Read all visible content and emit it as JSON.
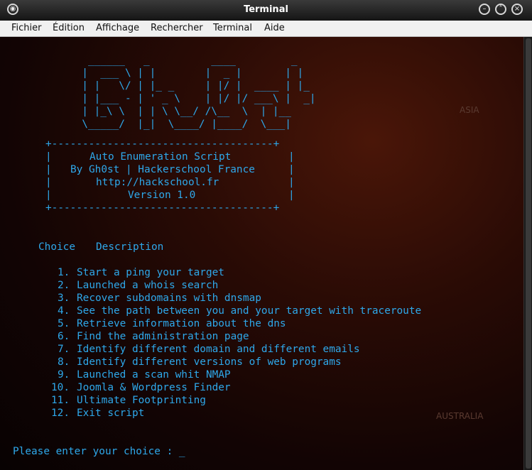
{
  "window": {
    "title": "Terminal"
  },
  "menu": [
    "Fichier",
    "Édition",
    "Affichage",
    "Rechercher",
    "Terminal",
    "Aide"
  ],
  "colors": {
    "terminal_text": "#2ea8ea"
  },
  "banner": {
    "ascii": [
      "         ______   _          ____         _",
      "        |  ___ \\ | |        |  _ |       | |",
      "        | |   \\/ | |_ _     | |/ |  ____ | |_",
      "        | |___ - | ' _ \\    | |/ |/ ___\\ |  _|",
      "        | |_\\ \\  | | \\ \\__/ /\\__  \\  | |__",
      "        \\_____/  |_|  \\____/ |____/  \\___|"
    ],
    "box_border": "+------------------------------------+",
    "box_lines": [
      "Auto Enumeration Script",
      "By Gh0st | Hackerschool France",
      "http://hackschool.fr",
      "Version 1.0"
    ]
  },
  "header": {
    "choice": "Choice",
    "description": "Description"
  },
  "options": [
    {
      "num": "1.",
      "text": "Start a ping your target"
    },
    {
      "num": "2.",
      "text": "Launched a whois search"
    },
    {
      "num": "3.",
      "text": "Recover subdomains with dnsmap"
    },
    {
      "num": "4.",
      "text": "See the path between you and your target with traceroute"
    },
    {
      "num": "5.",
      "text": "Retrieve information about the dns"
    },
    {
      "num": "6.",
      "text": "Find the administration page"
    },
    {
      "num": "7.",
      "text": "Identify different domain and different emails"
    },
    {
      "num": "8.",
      "text": "Identify different versions of web programs"
    },
    {
      "num": "9.",
      "text": "Launched a scan whit NMAP"
    },
    {
      "num": "10.",
      "text": "Joomla & Wordpress Finder"
    },
    {
      "num": "11.",
      "text": "Ultimate Footprinting"
    },
    {
      "num": "12.",
      "text": "Exit script"
    }
  ],
  "prompt": "Please enter your choice : _",
  "map_labels": [
    "ASIA",
    "AUSTRALIA"
  ]
}
